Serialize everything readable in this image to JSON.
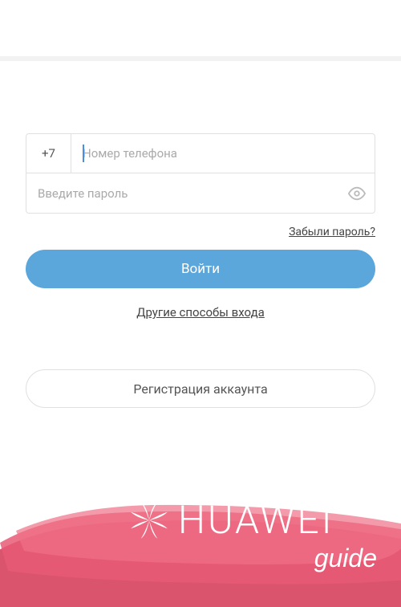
{
  "phone": {
    "country_code": "+7",
    "placeholder": "Номер телефона",
    "value": ""
  },
  "password": {
    "placeholder": "Введите пароль",
    "value": ""
  },
  "links": {
    "forgot": "Забыли пароль?",
    "other_methods": "Другие способы входа"
  },
  "buttons": {
    "login": "Войти",
    "register": "Регистрация аккаунта"
  },
  "watermark": {
    "brand": "HUAWEI",
    "sub": "guide"
  }
}
